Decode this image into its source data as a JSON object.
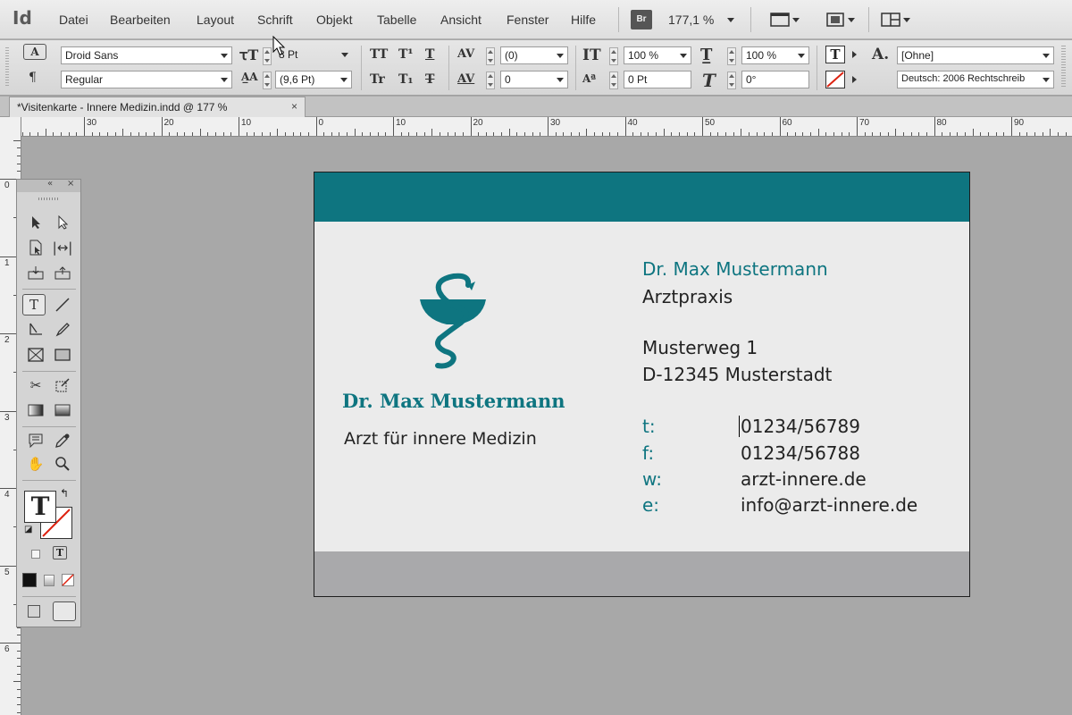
{
  "app": {
    "logo": "Id",
    "bridge": "Br",
    "zoom": "177,1 %"
  },
  "menu": [
    "Datei",
    "Bearbeiten",
    "Layout",
    "Schrift",
    "Objekt",
    "Tabelle",
    "Ansicht",
    "Fenster",
    "Hilfe"
  ],
  "control": {
    "font_family": "Droid Sans",
    "font_style": "Regular",
    "font_size": "8 Pt",
    "leading": "(9,6 Pt)",
    "kerning": "(0)",
    "tracking": "0",
    "v_scale": "100 %",
    "h_scale": "100 %",
    "baseline_shift": "0 Pt",
    "skew": "0°",
    "char_style": "[Ohne]",
    "language": "Deutsch: 2006 Rechtschreib"
  },
  "document": {
    "tab_title": "*Visitenkarte - Innere Medizin.indd @ 177 %",
    "close": "×"
  },
  "ruler_h": [
    "30",
    "20",
    "10",
    "0",
    "10",
    "20",
    "30",
    "40",
    "50",
    "60",
    "70",
    "80",
    "90"
  ],
  "ruler_v": [
    "0",
    "1",
    "2",
    "3",
    "4",
    "5",
    "6"
  ],
  "card": {
    "left_name": "Dr. Max Mustermann",
    "left_subtitle": "Arzt für innere Medizin",
    "right_name": "Dr. Max Mustermann",
    "practice": "Arztpraxis",
    "street": "Musterweg 1",
    "city": "D-12345 Musterstadt",
    "contacts": [
      {
        "label": "t:",
        "value": "01234/56789"
      },
      {
        "label": "f:",
        "value": "01234/56788"
      },
      {
        "label": "w:",
        "value": "arzt-innere.de"
      },
      {
        "label": "e:",
        "value": "info@arzt-innere.de"
      }
    ]
  },
  "colors": {
    "teal": "#0e7580",
    "card_bg": "#ebebeb",
    "footer": "#a9a9ab",
    "pasteboard": "#a8a8a8"
  }
}
